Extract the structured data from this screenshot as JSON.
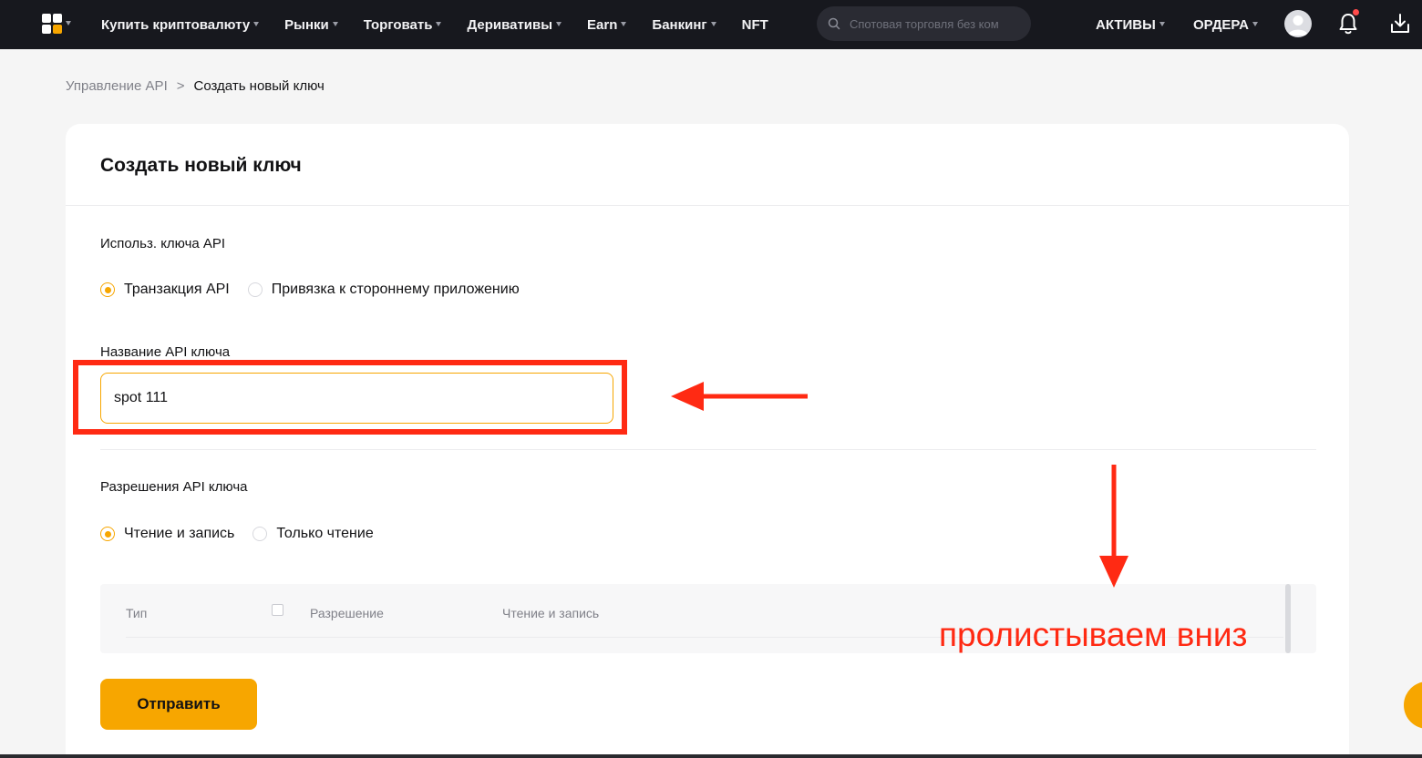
{
  "nav": {
    "items": [
      {
        "label": "Купить криптовалюту",
        "has_caret": true
      },
      {
        "label": "Рынки",
        "has_caret": true
      },
      {
        "label": "Торговать",
        "has_caret": true
      },
      {
        "label": "Деривативы",
        "has_caret": true
      },
      {
        "label": "Earn",
        "has_caret": true
      },
      {
        "label": "Банкинг",
        "has_caret": true
      },
      {
        "label": "NFT",
        "has_caret": false
      }
    ],
    "search_placeholder": "Спотовая торговля без ком",
    "assets_label": "АКТИВЫ",
    "orders_label": "ОРДЕРА",
    "icons": {
      "logo": "app-grid-logo",
      "search": "search-icon",
      "avatar": "user-avatar",
      "bell": "bell-icon",
      "download": "download-icon"
    },
    "colors": {
      "background": "#17181e",
      "accent": "#f7a600",
      "notification": "#ff4b4b"
    }
  },
  "breadcrumb": {
    "parent": "Управление API",
    "separator": ">",
    "current": "Создать новый ключ"
  },
  "form": {
    "title": "Создать новый ключ",
    "usage_label": "Использ. ключа API",
    "usage_options": [
      {
        "label": "Транзакция API",
        "checked": true
      },
      {
        "label": "Привязка к стороннему приложению",
        "checked": false
      }
    ],
    "name_label": "Название API ключа",
    "name_value": "spot 111",
    "permissions_label": "Разрешения API ключа",
    "permission_options": [
      {
        "label": "Чтение и запись",
        "checked": true
      },
      {
        "label": "Только чтение",
        "checked": false
      }
    ],
    "table_headers": {
      "type": "Тип",
      "permission": "Разрешение",
      "read_write": "Чтение и запись"
    },
    "submit_label": "Отправить"
  },
  "annotation": {
    "caption": "пролистываем вниз",
    "color": "#ff2a13"
  }
}
